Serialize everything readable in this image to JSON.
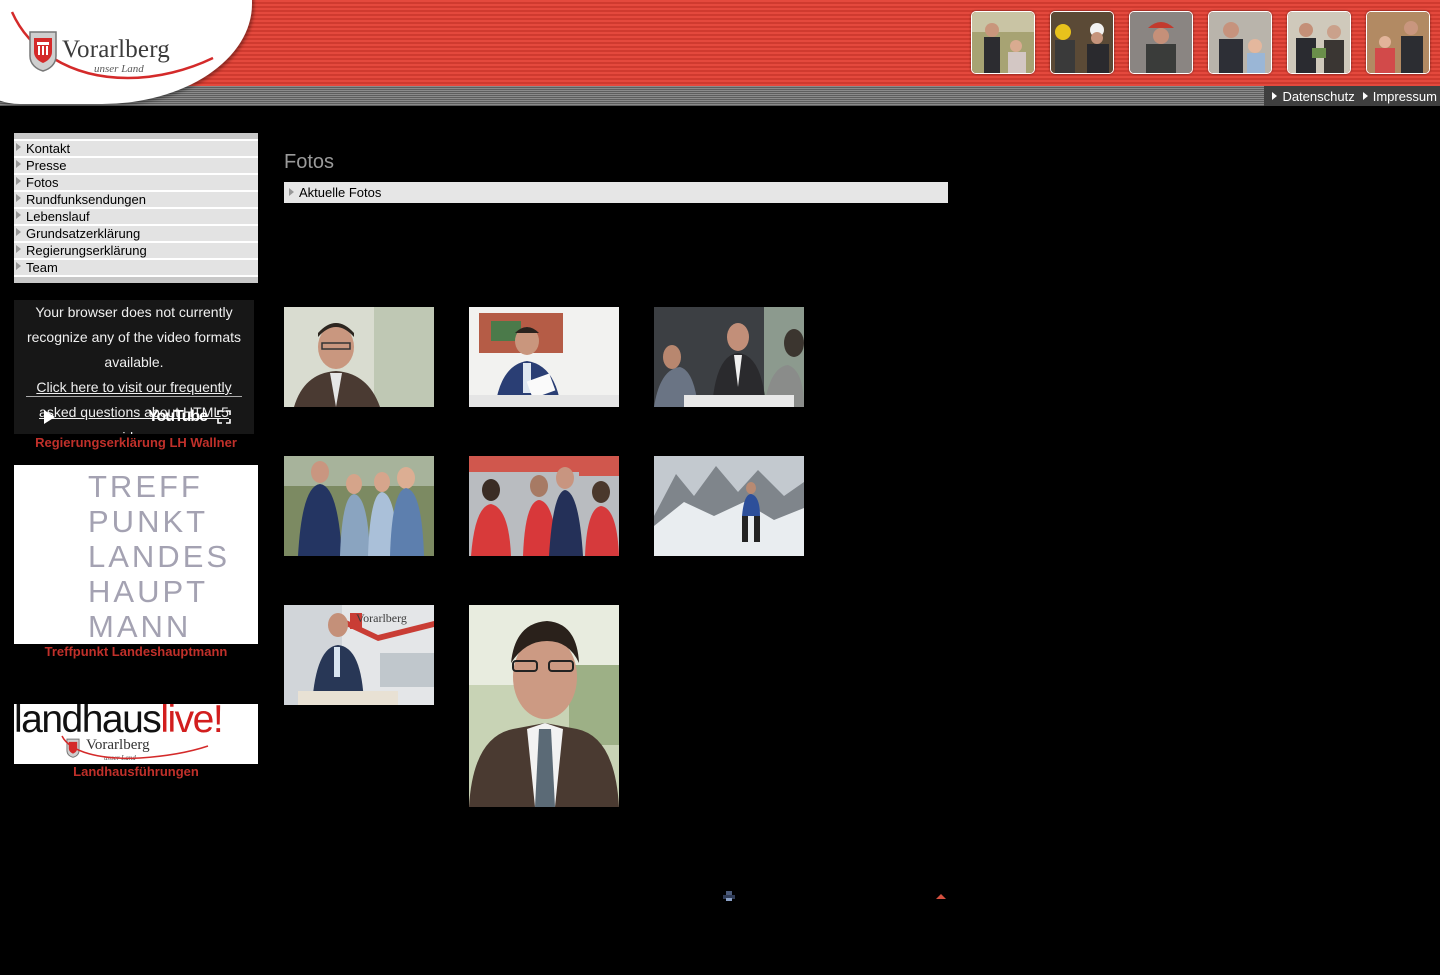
{
  "header": {
    "logo_text": "Vorarlberg",
    "logo_subtext": "unser Land",
    "links": [
      {
        "label": "Datenschutz"
      },
      {
        "label": "Impressum"
      }
    ]
  },
  "nav": {
    "items": [
      {
        "label": "Kontakt"
      },
      {
        "label": "Presse"
      },
      {
        "label": "Fotos"
      },
      {
        "label": "Rundfunksendungen"
      },
      {
        "label": "Lebenslauf"
      },
      {
        "label": "Grundsatzerklärung"
      },
      {
        "label": "Regierungserklärung"
      },
      {
        "label": "Team"
      }
    ]
  },
  "video": {
    "message": "Your browser does not currently recognize any of the video formats available.",
    "link_text": "Click here to visit our frequently asked questions about HTML5 video.",
    "brand": "YouTube",
    "caption": "Regierungserklärung LH Wallner"
  },
  "treff": {
    "lines": [
      "TREFF",
      "PUNKT",
      "LANDES",
      "HAUPT",
      "MANN"
    ],
    "caption": "Treffpunkt Landeshauptmann"
  },
  "landhaus": {
    "text_main": "landhaus",
    "text_accent": "live!",
    "logo_text": "Vorarlberg",
    "logo_subtext": "unser Land",
    "caption": "Landhausführungen"
  },
  "main": {
    "title": "Fotos",
    "section_label": "Aktuelle Fotos"
  },
  "colors": {
    "header_red": "#e4493d",
    "caption_red": "#c0302a",
    "background": "#000000",
    "nav_item_bg": "#e3e3e3"
  }
}
